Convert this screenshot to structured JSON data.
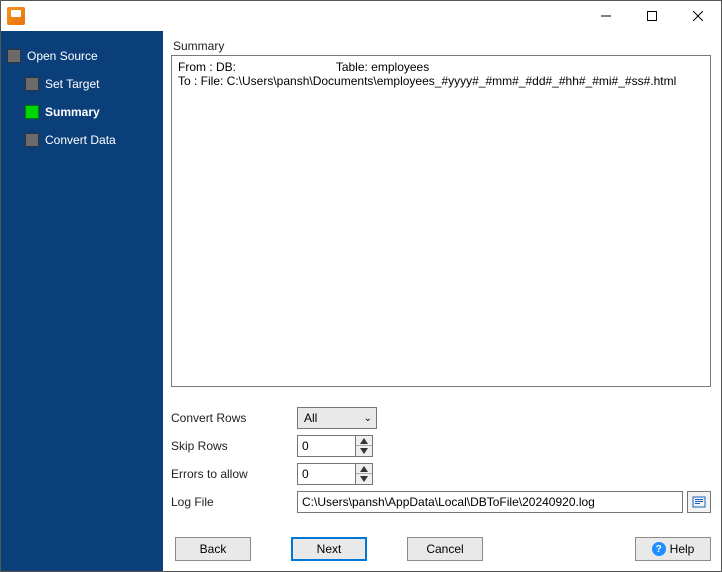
{
  "sidebar": {
    "items": [
      {
        "label": "Open Source",
        "active": false
      },
      {
        "label": "Set Target",
        "active": false
      },
      {
        "label": "Summary",
        "active": true
      },
      {
        "label": "Convert Data",
        "active": false
      }
    ]
  },
  "section_title": "Summary",
  "summary": {
    "from_label": "From : DB:",
    "table_label": "Table: employees",
    "to_line": "To : File: C:\\Users\\pansh\\Documents\\employees_#yyyy#_#mm#_#dd#_#hh#_#mi#_#ss#.html"
  },
  "form": {
    "convert_rows_label": "Convert Rows",
    "convert_rows_value": "All",
    "skip_rows_label": "Skip Rows",
    "skip_rows_value": "0",
    "errors_label": "Errors to allow",
    "errors_value": "0",
    "logfile_label": "Log File",
    "logfile_value": "C:\\Users\\pansh\\AppData\\Local\\DBToFile\\20240920.log"
  },
  "buttons": {
    "back": "Back",
    "next": "Next",
    "cancel": "Cancel",
    "help": "Help"
  }
}
